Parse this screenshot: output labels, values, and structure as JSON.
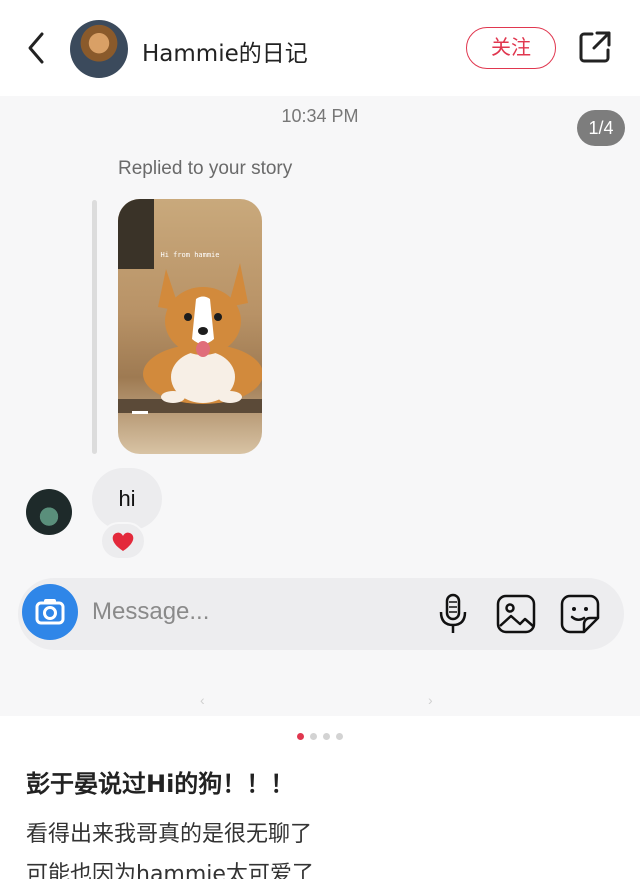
{
  "header": {
    "title": "Hammie的日记",
    "follow_label": "关注",
    "icons": [
      "back-chevron-icon",
      "share-icon"
    ]
  },
  "screenshot": {
    "time": "10:34 PM",
    "page_counter": "1/4",
    "replied_label": "Replied to your story",
    "story_caption": "Hi from hammie",
    "message_text": "hi",
    "reaction": "❤️",
    "composer_placeholder": "Message...",
    "icons": [
      "camera-icon",
      "microphone-icon",
      "gallery-icon",
      "sticker-icon"
    ]
  },
  "carousel": {
    "total": 4,
    "active": 1
  },
  "post": {
    "title": "彭于晏说过Hi的狗！！！",
    "lines": [
      "看得出来我哥真的是很无聊了",
      "可能也因为hammie太可爱了"
    ]
  },
  "colors": {
    "accent": "#e0374f",
    "camera_blue": "#2f86e8",
    "bubble": "#ececee"
  }
}
